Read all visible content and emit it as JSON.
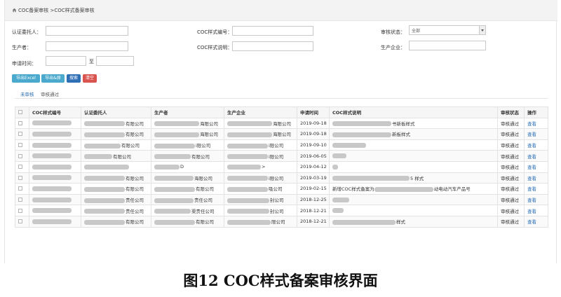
{
  "breadcrumb": "COC备案审核 >COC样式备案审核",
  "filters": {
    "applicant_label": "认证委托人：",
    "style_no_label": "COC样式编号：",
    "status_label": "审核状态：",
    "status_value": "全部",
    "producer_label": "生产者：",
    "style_desc_label": "COC样式说明：",
    "manufacturer_label": "生产企业：",
    "apply_time_label": "申请时间：",
    "to_label": "至"
  },
  "buttons": {
    "export_excel": "导出Excel",
    "export_pdf": "导出&原",
    "search": "搜索",
    "clear": "清空"
  },
  "tabs": [
    {
      "label": "未审核"
    },
    {
      "label": "审核通过"
    }
  ],
  "table": {
    "headers": [
      "COC样式编号",
      "认证委托人",
      "生产者",
      "生产企业",
      "申请时间",
      "COC样式说明",
      "审核状态",
      "操作"
    ],
    "rows": [
      {
        "applicant": "有限公司",
        "producer": "海限公司",
        "manufacturer": "海限公司",
        "date": "2019-09-18",
        "desc": "书新板样式",
        "status": "审核通过",
        "action": "查看"
      },
      {
        "applicant": "有限公司",
        "producer": "海限公司",
        "manufacturer": "海限公司",
        "date": "2019-09-18",
        "desc": "新板样式",
        "status": "审核通过",
        "action": "查看"
      },
      {
        "applicant": "有限公司",
        "producer": "i限公司",
        "manufacturer": "i限公司",
        "date": "2019-09-10",
        "desc": "",
        "status": "审核通过",
        "action": "查看"
      },
      {
        "applicant": "有限公司",
        "producer": "有限公司",
        "manufacturer": "i限公司",
        "date": "2019-06-05",
        "desc": "",
        "status": "审核通过",
        "action": "查看"
      },
      {
        "applicant": "",
        "producer": "D",
        "manufacturer": ">",
        "date": "2019-04-12",
        "desc": "",
        "status": "审核通过",
        "action": "查看"
      },
      {
        "applicant": "有限公司",
        "producer": "海限公司",
        "manufacturer": "i限公司",
        "date": "2019-03-19",
        "desc": "5 样式",
        "status": "审核通过",
        "action": "查看"
      },
      {
        "applicant": "有限公司",
        "producer": "有限公司",
        "manufacturer": "吸公司",
        "date": "2019-02-15",
        "desc_prefix": "新增COC样式备案为",
        "desc": "动电动汽车产品号",
        "status": "审核通过",
        "action": "查看"
      },
      {
        "applicant": "责任公司",
        "producer": "责任公司",
        "manufacturer": "封公司",
        "date": "2018-12-25",
        "desc": "",
        "status": "审核通过",
        "action": "查看"
      },
      {
        "applicant": "责任公司",
        "producer": "渠责任公司",
        "manufacturer": "封公司",
        "date": "2018-12-21",
        "desc": "",
        "status": "审核通过",
        "action": "查看"
      },
      {
        "applicant": "有限公司",
        "producer": "有限公司",
        "manufacturer": "限公司",
        "date": "2018-12-21",
        "desc": "样式",
        "status": "审核通过",
        "action": "查看"
      }
    ]
  },
  "caption": "图12   COC样式备案审核界面",
  "colors": {
    "btn_teal": "#4aa9cc",
    "btn_blue": "#2f6fb5",
    "btn_red": "#d9534f",
    "link_blue": "#2a6fb5"
  }
}
